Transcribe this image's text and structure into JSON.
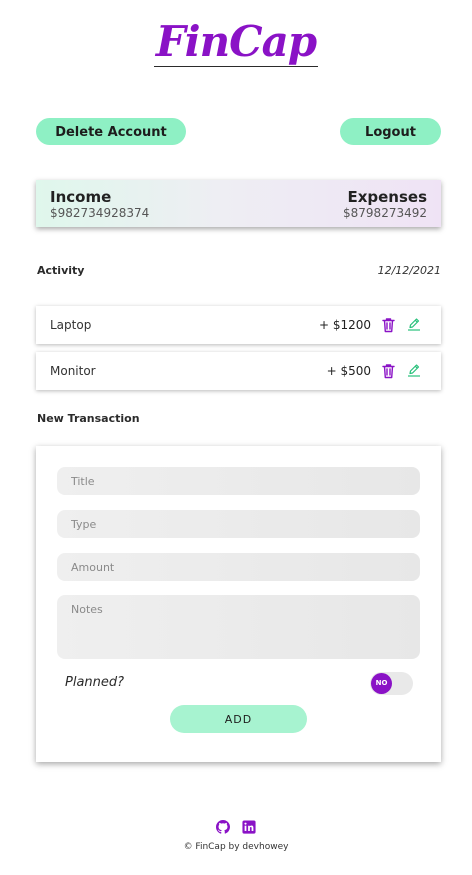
{
  "app": {
    "logo_text": "FinCap"
  },
  "header": {
    "delete_account_label": "Delete Account",
    "logout_label": "Logout"
  },
  "summary": {
    "income_label": "Income",
    "income_value": "$982734928374",
    "expenses_label": "Expenses",
    "expenses_value": "$8798273492"
  },
  "activity": {
    "title": "Activity",
    "date": "12/12/2021",
    "items": [
      {
        "name": "Laptop",
        "amount": "+ $1200"
      },
      {
        "name": "Monitor",
        "amount": "+ $500"
      }
    ]
  },
  "new_transaction": {
    "title": "New Transaction",
    "title_placeholder": "Title",
    "type_placeholder": "Type",
    "amount_placeholder": "Amount",
    "notes_placeholder": "Notes",
    "planned_label": "Planned?",
    "planned_toggle_text": "NO",
    "add_label": "ADD"
  },
  "footer": {
    "icons": [
      "github-icon",
      "linkedin-icon"
    ],
    "copyright": "© FinCap by devhowey"
  },
  "colors": {
    "brand_purple": "#8a12c6",
    "accent_mint": "#8ef0c4",
    "edit_green": "#27c07a"
  }
}
